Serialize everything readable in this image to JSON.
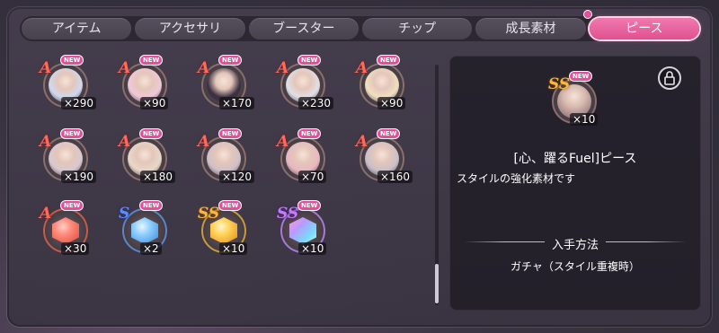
{
  "tabs": [
    {
      "label": "アイテム",
      "active": false
    },
    {
      "label": "アクセサリ",
      "active": false
    },
    {
      "label": "ブースター",
      "active": false
    },
    {
      "label": "チップ",
      "active": false
    },
    {
      "label": "成長素材",
      "active": false
    },
    {
      "label": "ピース",
      "active": true
    }
  ],
  "badge_text": "NEW",
  "items": [
    {
      "rank": "A",
      "type": "character",
      "qty": "×290"
    },
    {
      "rank": "A",
      "type": "character",
      "qty": "×90"
    },
    {
      "rank": "A",
      "type": "character",
      "qty": "×170"
    },
    {
      "rank": "A",
      "type": "character",
      "qty": "×230"
    },
    {
      "rank": "A",
      "type": "character",
      "qty": "×90"
    },
    {
      "rank": "A",
      "type": "character",
      "qty": "×190"
    },
    {
      "rank": "A",
      "type": "character",
      "qty": "×180"
    },
    {
      "rank": "A",
      "type": "character",
      "qty": "×120"
    },
    {
      "rank": "A",
      "type": "character",
      "qty": "×70"
    },
    {
      "rank": "A",
      "type": "character",
      "qty": "×160"
    },
    {
      "rank": "A",
      "type": "gem-red",
      "qty": "×30"
    },
    {
      "rank": "S",
      "type": "gem-blue",
      "qty": "×2"
    },
    {
      "rank": "SS",
      "type": "gem-gold",
      "qty": "×10"
    },
    {
      "rank": "SS",
      "type": "gem-rainbow",
      "qty": "×10"
    }
  ],
  "detail": {
    "rank": "SS",
    "qty": "×10",
    "title": "[心、躍るFuel]ピース",
    "description": "スタイルの強化素材です",
    "section_title": "入手方法",
    "section_value": "ガチャ（スタイル重複時）"
  },
  "colors": {
    "accent": "#e64d9a",
    "rank_A": "#ff6a5a",
    "rank_S": "#5a8cff",
    "rank_SS": "#ffb43a"
  }
}
